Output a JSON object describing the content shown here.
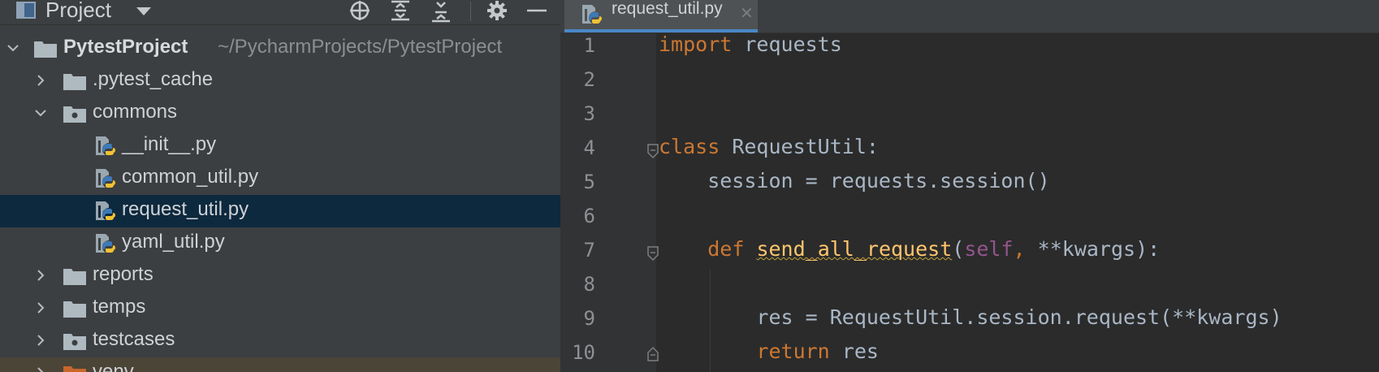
{
  "project_panel": {
    "title": "Project",
    "tree": [
      {
        "label": "PytestProject",
        "path": "~/PycharmProjects/PytestProject",
        "type": "project-root",
        "expanded": true
      },
      {
        "label": ".pytest_cache",
        "type": "folder",
        "expanded": false
      },
      {
        "label": "commons",
        "type": "package",
        "expanded": true
      },
      {
        "label": "__init__.py",
        "type": "python-file"
      },
      {
        "label": "common_util.py",
        "type": "python-file"
      },
      {
        "label": "request_util.py",
        "type": "python-file",
        "selected": true
      },
      {
        "label": "yaml_util.py",
        "type": "python-file"
      },
      {
        "label": "reports",
        "type": "folder",
        "expanded": false
      },
      {
        "label": "temps",
        "type": "folder",
        "expanded": false
      },
      {
        "label": "testcases",
        "type": "package",
        "expanded": false
      },
      {
        "label": "venv",
        "type": "excluded-folder",
        "expanded": false
      }
    ]
  },
  "editor": {
    "active_tab": "request_util.py",
    "line_numbers": [
      "1",
      "2",
      "3",
      "4",
      "5",
      "6",
      "7",
      "8",
      "9",
      "10"
    ],
    "code": {
      "l1_kw": "import",
      "l1_rest": " requests",
      "l4_kw": "class",
      "l4_rest": " RequestUtil:",
      "l5": "    session = requests.session()",
      "l7_indent": "    ",
      "l7_kw": "def",
      "l7_sp": " ",
      "l7_fn": "send_all_request",
      "l7_paren": "(",
      "l7_self": "self",
      "l7_comma": ",",
      "l7_rest": " **kwargs):",
      "l9": "        res = RequestUtil.session.request(**kwargs)",
      "l10_indent": "        ",
      "l10_kw": "return",
      "l10_rest": " res"
    }
  },
  "colors": {
    "panel_bg": "#3c3f41",
    "editor_bg": "#2b2b2b",
    "selection": "#0d293e",
    "keyword": "#cc7832",
    "function": "#ffc66d",
    "self": "#94558d",
    "accent": "#4a88c7"
  }
}
